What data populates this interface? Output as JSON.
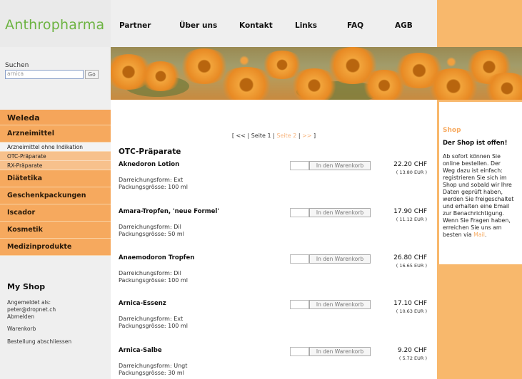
{
  "brand": {
    "logo": "Anthropharma"
  },
  "topnav": [
    {
      "label": "Partner"
    },
    {
      "label": "Über uns"
    },
    {
      "label": "Kontakt"
    },
    {
      "label": "Links"
    },
    {
      "label": "FAQ"
    },
    {
      "label": "AGB"
    }
  ],
  "search": {
    "label": "Suchen",
    "value": "arnica",
    "go_label": "Go"
  },
  "sidebar": {
    "heading": "Weleda",
    "categories": [
      {
        "label": "Arzneimittel",
        "subitems": [
          {
            "label": "Arzneimittel ohne Indikation"
          },
          {
            "label": "OTC-Präparate"
          },
          {
            "label": "RX-Präparate"
          }
        ]
      },
      {
        "label": "Diätetika"
      },
      {
        "label": "Geschenkpackungen"
      },
      {
        "label": "Iscador"
      },
      {
        "label": "Kosmetik"
      },
      {
        "label": "Medizinprodukte"
      }
    ]
  },
  "myshop": {
    "title": "My Shop",
    "logged_in_as": "Angemeldet als:",
    "email": "peter@dropnet.ch",
    "logout": "Abmelden",
    "cart": "Warenkorb",
    "checkout": "Bestellung abschliessen"
  },
  "pager": {
    "open": "[ <<",
    "sep1": " | ",
    "page1": "Seite 1",
    "sep2": " | ",
    "page2": "Seite 2",
    "sep3": " | ",
    "next": ">>",
    "close": " ]"
  },
  "section_title": "OTC-Präparate",
  "cart_button_label": "In den Warenkorb",
  "products": [
    {
      "name": "Aknedoron Lotion",
      "form": "Darreichungsform: Ext",
      "size": "Packungsgrösse: 100 ml",
      "price_chf": "22.20 CHF",
      "price_eur": "( 13.80 EUR )"
    },
    {
      "name": "Amara-Tropfen, 'neue Formel'",
      "form": "Darreichungsform: Dil",
      "size": "Packungsgrösse: 50 ml",
      "price_chf": "17.90 CHF",
      "price_eur": "( 11.12 EUR )"
    },
    {
      "name": "Anaemodoron Tropfen",
      "form": "Darreichungsform: Dil",
      "size": "Packungsgrösse: 100 ml",
      "price_chf": "26.80 CHF",
      "price_eur": "( 16.65 EUR )"
    },
    {
      "name": "Arnica-Essenz",
      "form": "Darreichungsform: Ext",
      "size": "Packungsgrösse: 100 ml",
      "price_chf": "17.10 CHF",
      "price_eur": "( 10.63 EUR )"
    },
    {
      "name": "Arnica-Salbe",
      "form": "Darreichungsform: Ungt",
      "size": "Packungsgrösse: 30 ml",
      "price_chf": "9.20 CHF",
      "price_eur": "( 5.72 EUR )"
    }
  ],
  "shop_box": {
    "heading": "Shop",
    "subheading": "Der Shop ist offen!",
    "lines": [
      "Ab sofort können Sie",
      "online bestellen. Der",
      "Weg dazu ist einfach:",
      "registrieren Sie sich im",
      "Shop und sobald wir Ihre",
      "Daten geprüft haben,",
      "werden Sie freigeschaltet",
      "und erhalten eine Email",
      "zur Benachrichtigung.",
      "Wenn Sie Fragen haben,",
      "erreichen Sie uns am"
    ],
    "last_line_prefix": "besten via ",
    "mail_link": "Mail",
    "last_line_suffix": "."
  },
  "colors": {
    "accent_orange": "#f8b86c",
    "logo_green": "#6cb341",
    "sidebar_gray": "#efefef"
  }
}
